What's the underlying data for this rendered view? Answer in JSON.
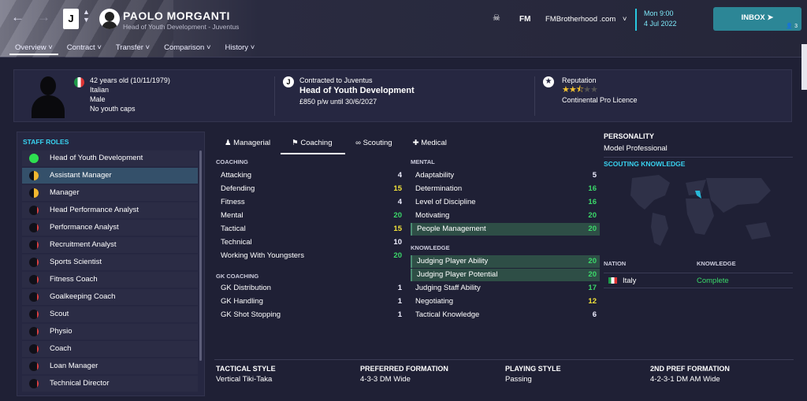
{
  "header": {
    "name": "PAOLO MORGANTI",
    "subtitle": "Head of Youth Development - Juventus",
    "fm": "FM",
    "site": "FMBrotherhood .com",
    "date_line1": "Mon 9:00",
    "date_line2": "4 Jul 2022",
    "inbox": "INBOX",
    "inbox_count": "3",
    "badge": "J"
  },
  "tabs": [
    {
      "label": "Overview"
    },
    {
      "label": "Contract"
    },
    {
      "label": "Transfer"
    },
    {
      "label": "Comparison"
    },
    {
      "label": "History"
    }
  ],
  "summary": {
    "age": "42 years old (10/11/1979)",
    "nationality": "Italian",
    "gender": "Male",
    "caps": "No youth caps",
    "contract_label": "Contracted to Juventus",
    "job": "Head of Youth Development",
    "wage": "£850 p/w until 30/6/2027",
    "rep_label": "Reputation",
    "rep_stars": 2.5,
    "licence": "Continental Pro Licence"
  },
  "roles_title": "STAFF ROLES",
  "roles": [
    {
      "label": "Head of Youth Development"
    },
    {
      "label": "Assistant Manager"
    },
    {
      "label": "Manager"
    },
    {
      "label": "Head Performance Analyst"
    },
    {
      "label": "Performance Analyst"
    },
    {
      "label": "Recruitment Analyst"
    },
    {
      "label": "Sports Scientist"
    },
    {
      "label": "Fitness Coach"
    },
    {
      "label": "Goalkeeping Coach"
    },
    {
      "label": "Scout"
    },
    {
      "label": "Physio"
    },
    {
      "label": "Coach"
    },
    {
      "label": "Loan Manager"
    },
    {
      "label": "Technical Director"
    }
  ],
  "attr_tabs": [
    {
      "label": "Managerial"
    },
    {
      "label": "Coaching"
    },
    {
      "label": "Scouting"
    },
    {
      "label": "Medical"
    }
  ],
  "coaching_title": "COACHING",
  "coaching": [
    {
      "label": "Attacking",
      "value": "4"
    },
    {
      "label": "Defending",
      "value": "15"
    },
    {
      "label": "Fitness",
      "value": "4"
    },
    {
      "label": "Mental",
      "value": "20"
    },
    {
      "label": "Tactical",
      "value": "15"
    },
    {
      "label": "Technical",
      "value": "10"
    },
    {
      "label": "Working With Youngsters",
      "value": "20"
    }
  ],
  "gk_title": "GK COACHING",
  "gk": [
    {
      "label": "GK Distribution",
      "value": "1"
    },
    {
      "label": "GK Handling",
      "value": "1"
    },
    {
      "label": "GK Shot Stopping",
      "value": "1"
    }
  ],
  "mental_title": "MENTAL",
  "mental": [
    {
      "label": "Adaptability",
      "value": "5"
    },
    {
      "label": "Determination",
      "value": "16"
    },
    {
      "label": "Level of Discipline",
      "value": "16"
    },
    {
      "label": "Motivating",
      "value": "20"
    },
    {
      "label": "People Management",
      "value": "20"
    }
  ],
  "knowledge_title": "KNOWLEDGE",
  "knowledge": [
    {
      "label": "Judging Player Ability",
      "value": "20"
    },
    {
      "label": "Judging Player Potential",
      "value": "20"
    },
    {
      "label": "Judging Staff Ability",
      "value": "17"
    },
    {
      "label": "Negotiating",
      "value": "12"
    },
    {
      "label": "Tactical Knowledge",
      "value": "6"
    }
  ],
  "personality_title": "PERSONALITY",
  "personality": "Model Professional",
  "scouting_title": "SCOUTING KNOWLEDGE",
  "nation_hdr": "NATION",
  "knowledge_hdr": "KNOWLEDGE",
  "nation": "Italy",
  "nation_knowledge": "Complete",
  "bottom": {
    "tactical_style_label": "TACTICAL STYLE",
    "tactical_style": "Vertical Tiki-Taka",
    "pref_formation_label": "PREFERRED FORMATION",
    "pref_formation": "4-3-3 DM Wide",
    "playing_style_label": "PLAYING STYLE",
    "playing_style": "Passing",
    "second_formation_label": "2ND PREF FORMATION",
    "second_formation": "4-2-3-1 DM AM Wide"
  }
}
